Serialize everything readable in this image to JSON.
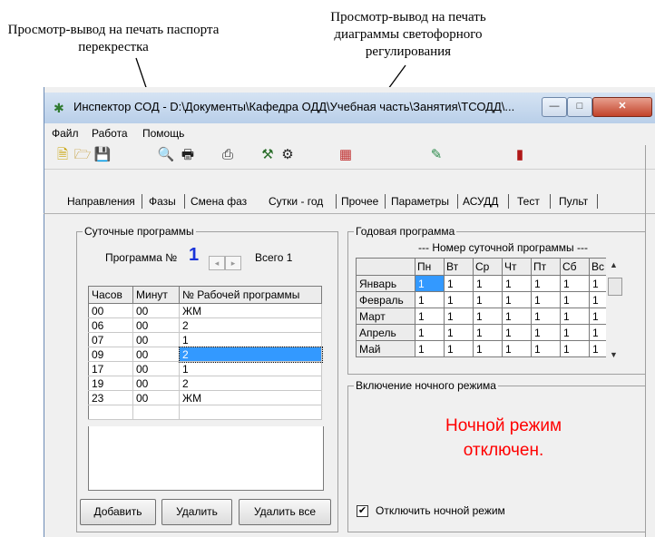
{
  "annotations": {
    "left_label": "Просмотр-вывод на печать паспорта перекрестка",
    "right_label": "Просмотр-вывод на печать диаграммы светофорного регулирования"
  },
  "window": {
    "title": "Инспектор СОД - D:\\Документы\\Кафедра ОДД\\Учебная часть\\Занятия\\ТСОДД\\...",
    "menu": [
      "Файл",
      "Работа",
      "Помощь"
    ],
    "toolbar_icons": [
      "new-icon",
      "open-icon",
      "save-icon",
      "print-preview-icon",
      "print-icon",
      "print-diagram-icon",
      "tools-icon",
      "settings-icon",
      "diagram-print-icon",
      "notes-icon",
      "exit-icon"
    ]
  },
  "tabs": [
    "Направления",
    "Фазы",
    "Смена фаз",
    "Сутки - год",
    "Прочее",
    "Параметры",
    "АСУДД",
    "Тест",
    "Пульт"
  ],
  "active_tab": "Сутки - год",
  "daily": {
    "group_label": "Суточные программы",
    "program_label": "Программа №",
    "program_number": "1",
    "total_label": "Всего 1",
    "columns": [
      "Часов",
      "Минут",
      "№ Рабочей программы"
    ],
    "rows": [
      [
        "00",
        "00",
        "ЖМ"
      ],
      [
        "06",
        "00",
        "2"
      ],
      [
        "07",
        "00",
        "1"
      ],
      [
        "09",
        "00",
        "2"
      ],
      [
        "17",
        "00",
        "1"
      ],
      [
        "19",
        "00",
        "2"
      ],
      [
        "23",
        "00",
        "ЖМ"
      ]
    ],
    "selected_row": 3,
    "buttons": {
      "add": "Добавить",
      "delete": "Удалить",
      "delete_all": "Удалить все"
    }
  },
  "yearly": {
    "group_label": "Годовая программа",
    "caption": "---  Номер суточной программы  ---",
    "days": [
      "Пн",
      "Вт",
      "Ср",
      "Чт",
      "Пт",
      "Сб",
      "Вс"
    ],
    "rows": [
      {
        "month": "Январь",
        "values": [
          "1",
          "1",
          "1",
          "1",
          "1",
          "1",
          "1"
        ]
      },
      {
        "month": "Февраль",
        "values": [
          "1",
          "1",
          "1",
          "1",
          "1",
          "1",
          "1"
        ]
      },
      {
        "month": "Март",
        "values": [
          "1",
          "1",
          "1",
          "1",
          "1",
          "1",
          "1"
        ]
      },
      {
        "month": "Апрель",
        "values": [
          "1",
          "1",
          "1",
          "1",
          "1",
          "1",
          "1"
        ]
      },
      {
        "month": "Май",
        "values": [
          "1",
          "1",
          "1",
          "1",
          "1",
          "1",
          "1"
        ]
      }
    ]
  },
  "night": {
    "group_label": "Включение ночного режима",
    "status_line1": "Ночной режим",
    "status_line2": "отключен.",
    "checkbox_label": "Отключить ночной режим",
    "checkbox_checked": true,
    "status_color": "#ff0000"
  }
}
